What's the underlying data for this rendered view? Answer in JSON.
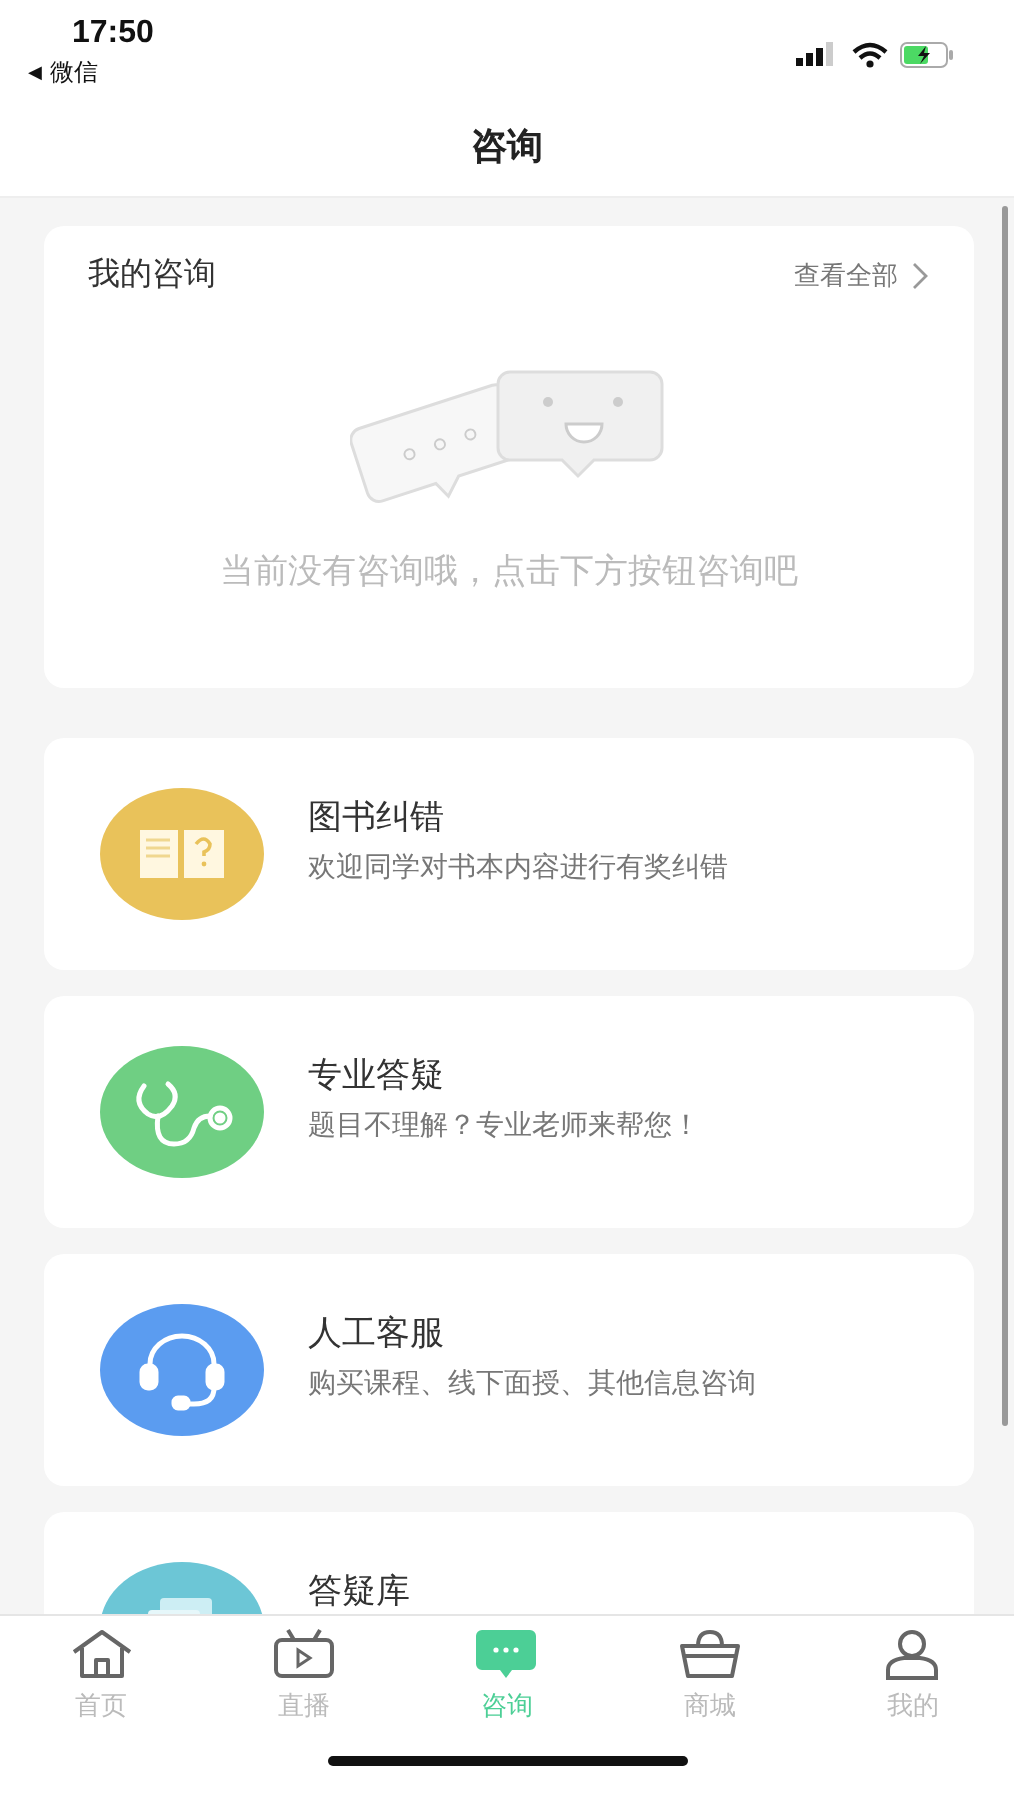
{
  "status_bar": {
    "time": "17:50",
    "back_arrow": "◀",
    "back_app": "微信"
  },
  "header": {
    "title": "咨询"
  },
  "my_consult": {
    "title": "我的咨询",
    "view_all": "查看全部",
    "empty_text": "当前没有咨询哦，点击下方按钮咨询吧"
  },
  "services": [
    {
      "kind": "book",
      "title": "图书纠错",
      "description": "欢迎同学对书本内容进行有奖纠错",
      "color": "#e9c25a"
    },
    {
      "kind": "stethoscope",
      "title": "专业答疑",
      "description": "题目不理解？专业老师来帮您！",
      "color": "#6fcf83"
    },
    {
      "kind": "headset",
      "title": "人工客服",
      "description": "购买课程、线下面授、其他信息咨询",
      "color": "#5b9cf0"
    },
    {
      "kind": "document",
      "title": "答疑库",
      "color": "#6cc6d6"
    }
  ],
  "tabs": [
    {
      "kind": "home",
      "label": "首页",
      "selected": false
    },
    {
      "kind": "tv",
      "label": "直播",
      "selected": false
    },
    {
      "kind": "chat",
      "label": "咨询",
      "selected": true
    },
    {
      "kind": "basket",
      "label": "商城",
      "selected": false
    },
    {
      "kind": "user",
      "label": "我的",
      "selected": false
    }
  ]
}
